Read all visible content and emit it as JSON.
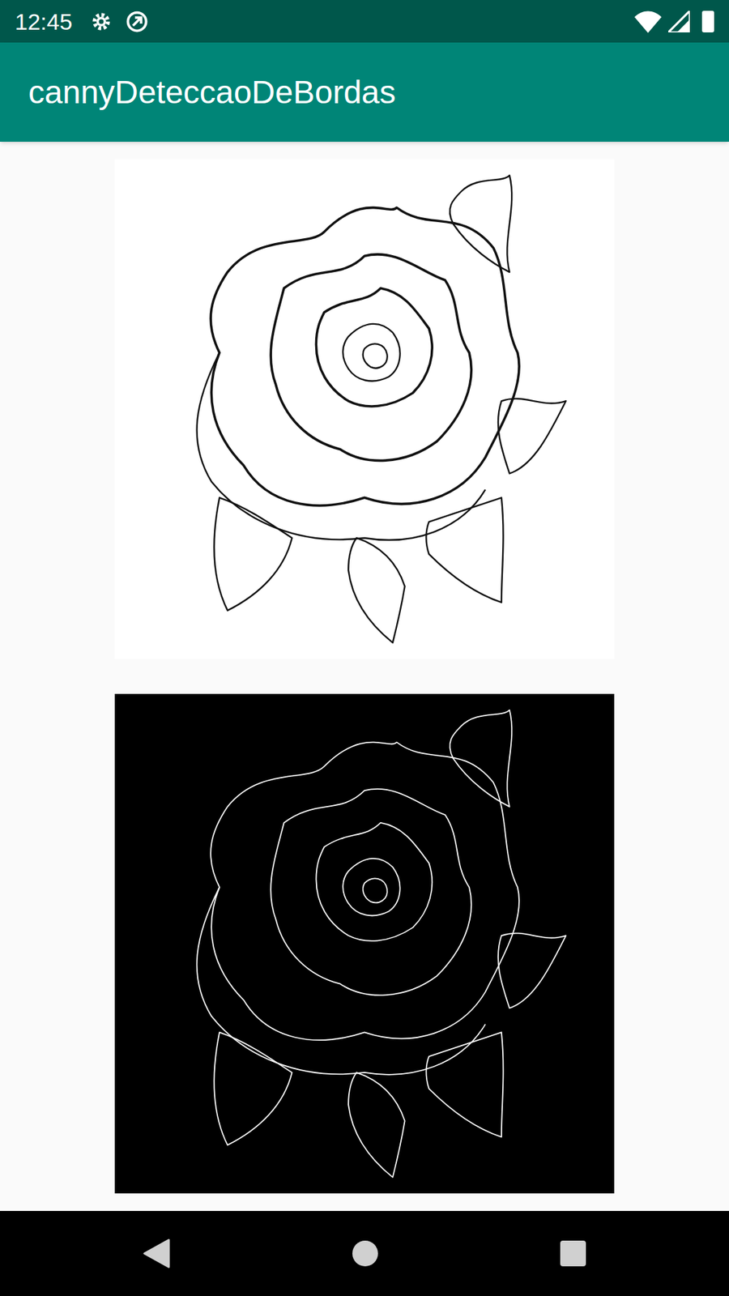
{
  "status_bar": {
    "time": "12:45"
  },
  "app_bar": {
    "title": "cannyDeteccaoDeBordas"
  },
  "images": [
    {
      "kind": "original"
    },
    {
      "kind": "edges"
    }
  ]
}
